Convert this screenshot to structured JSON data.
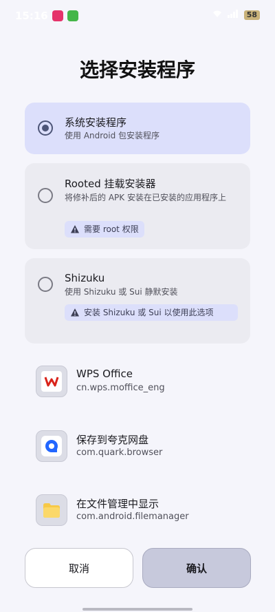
{
  "status_bar": {
    "time": "15:16",
    "battery": "58"
  },
  "dialog": {
    "title": "选择安装程序",
    "options": [
      {
        "title": "系统安装程序",
        "description": "使用 Android 包安装程序",
        "selected": true
      },
      {
        "title": "Rooted 挂载安装器",
        "description": "将修补后的 APK 安装在已安装的应用程序上",
        "warning": "需要 root 权限",
        "selected": false
      },
      {
        "title": "Shizuku",
        "description": "使用 Shizuku 或 Sui 静默安装",
        "warning": "安装 Shizuku 或 Sui 以使用此选项",
        "selected": false
      }
    ],
    "apps": [
      {
        "name": "WPS Office",
        "package": "cn.wps.moffice_eng",
        "icon": "wps-office-icon"
      },
      {
        "name": "保存到夸克网盘",
        "package": "com.quark.browser",
        "icon": "quark-icon"
      },
      {
        "name": "在文件管理中显示",
        "package": "com.android.filemanager",
        "icon": "folder-icon"
      }
    ],
    "cancel_label": "取消",
    "confirm_label": "确认"
  },
  "colors": {
    "selected_card": "#dcdffb",
    "card": "#ebebf1",
    "background": "#f5f5fb",
    "wps_red": "#d9231a",
    "quark_blue": "#2266ff",
    "folder_yellow": "#f7c948"
  }
}
